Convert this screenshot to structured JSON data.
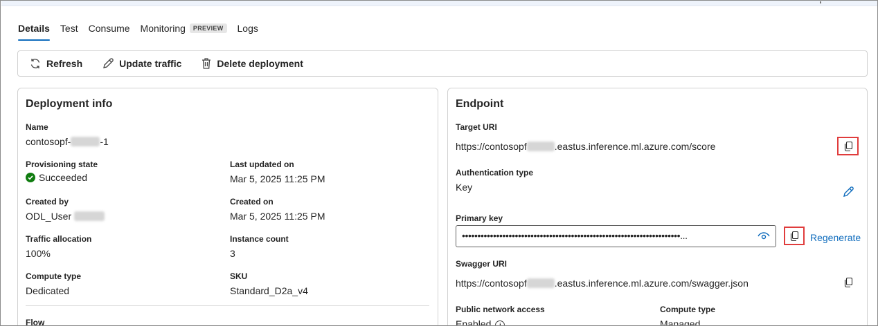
{
  "tabs": [
    {
      "label": "Details",
      "active": true
    },
    {
      "label": "Test"
    },
    {
      "label": "Consume"
    },
    {
      "label": "Monitoring",
      "badge": "PREVIEW"
    },
    {
      "label": "Logs"
    }
  ],
  "toolbar": {
    "refresh_label": "Refresh",
    "update_traffic_label": "Update traffic",
    "delete_deployment_label": "Delete deployment"
  },
  "deployment_info": {
    "title": "Deployment info",
    "name_label": "Name",
    "name_prefix": "contosopf-",
    "name_suffix": "-1",
    "provisioning_state_label": "Provisioning state",
    "provisioning_state_value": "Succeeded",
    "last_updated_label": "Last updated on",
    "last_updated_value": "Mar 5, 2025 11:25 PM",
    "created_by_label": "Created by",
    "created_by_value": "ODL_User",
    "created_on_label": "Created on",
    "created_on_value": "Mar 5, 2025 11:25 PM",
    "traffic_allocation_label": "Traffic allocation",
    "traffic_allocation_value": "100%",
    "instance_count_label": "Instance count",
    "instance_count_value": "3",
    "compute_type_label": "Compute type",
    "compute_type_value": "Dedicated",
    "sku_label": "SKU",
    "sku_value": "Standard_D2a_v4",
    "flow_label": "Flow"
  },
  "endpoint": {
    "title": "Endpoint",
    "target_uri_label": "Target URI",
    "target_uri_prefix": "https://contosopf",
    "target_uri_suffix": ".eastus.inference.ml.azure.com/score",
    "auth_type_label": "Authentication type",
    "auth_type_value": "Key",
    "primary_key_label": "Primary key",
    "primary_key_masked": "••••••••••••••••••••••••••••••••••••••••••••••••••••••••••••••••••••••...",
    "regenerate_label": "Regenerate",
    "swagger_uri_label": "Swagger URI",
    "swagger_uri_prefix": "https://contosopf",
    "swagger_uri_suffix": ".eastus.inference.ml.azure.com/swagger.json",
    "public_network_access_label": "Public network access",
    "public_network_access_value": "Enabled",
    "compute_type_label": "Compute type",
    "compute_type_value": "Managed"
  },
  "colors": {
    "accent": "#0f6cbd",
    "success": "#107c10",
    "highlight_box": "#e03c3c"
  },
  "icons": [
    "refresh-icon",
    "edit-icon",
    "delete-icon",
    "checkmark-icon",
    "copy-icon",
    "eye-icon",
    "info-icon"
  ]
}
